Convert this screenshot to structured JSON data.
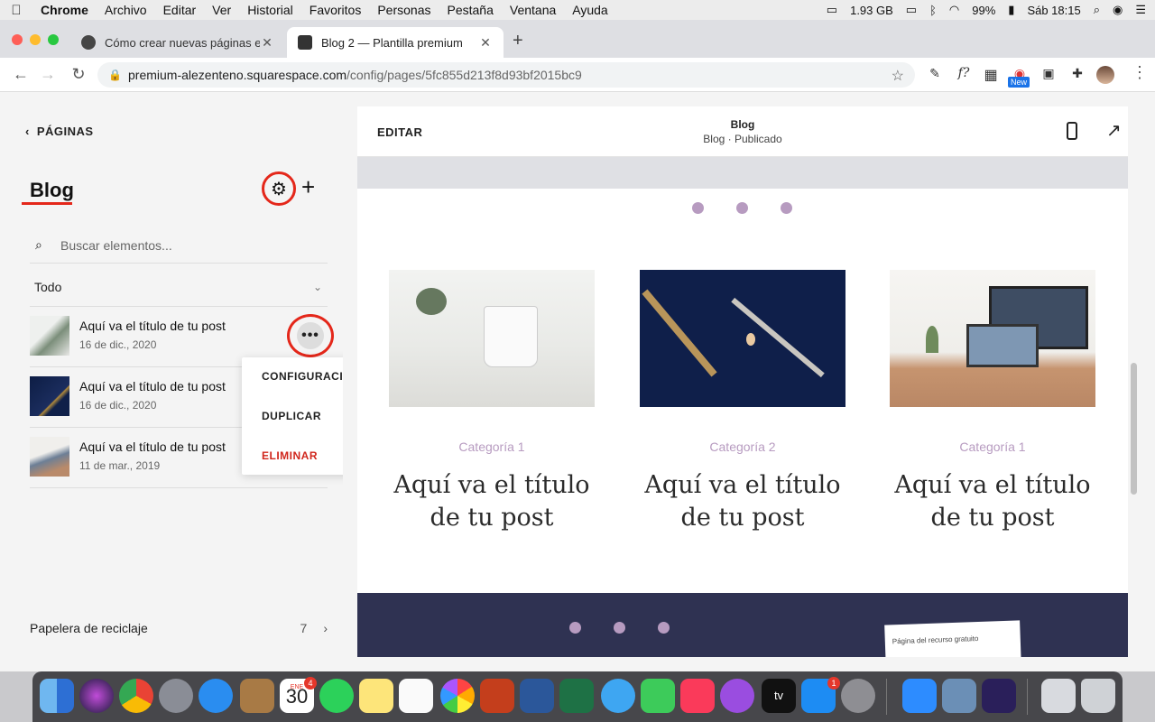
{
  "menubar": {
    "apple": "",
    "items": [
      "Chrome",
      "Archivo",
      "Editar",
      "Ver",
      "Historial",
      "Favoritos",
      "Personas",
      "Pestaña",
      "Ventana",
      "Ayuda"
    ],
    "memory": "1.93 GB",
    "battery": "99%",
    "clock": "Sáb 18:15"
  },
  "browser": {
    "tabs": [
      {
        "title": "Cómo crear nuevas páginas en",
        "close": "✕"
      },
      {
        "title": "Blog 2 — Plantilla premium",
        "close": "✕"
      }
    ],
    "new_tab": "+",
    "url_host": "premium-alezenteno.squarespace.com",
    "url_path": "/config/pages/5fc855d213f8d93bf2015bc9",
    "new_badge": "New"
  },
  "sidebar": {
    "back_label": "PÁGINAS",
    "title": "Blog",
    "search_placeholder": "Buscar elementos...",
    "filter_label": "Todo",
    "posts": [
      {
        "title": "Aquí va el título de tu post",
        "date": "16 de dic., 2020"
      },
      {
        "title": "Aquí va el título de tu post",
        "date": "16 de dic., 2020"
      },
      {
        "title": "Aquí va el título de tu post",
        "date": "11 de mar., 2019"
      }
    ],
    "more_glyph": "•••",
    "context_menu": {
      "settings": "CONFIGURACIÓN",
      "duplicate": "DUPLICAR",
      "delete": "ELIMINAR"
    },
    "trash_label": "Papelera de reciclaje",
    "trash_count": "7"
  },
  "preview": {
    "edit_label": "EDITAR",
    "page_title": "Blog",
    "page_status": "Blog · Publicado",
    "cards": [
      {
        "category": "Categoría 1",
        "title": "Aquí va el título de tu post",
        "image": "coffee-mug-desk"
      },
      {
        "category": "Categoría 2",
        "title": "Aquí va el título de tu post",
        "image": "navy-desk-tools"
      },
      {
        "category": "Categoría 1",
        "title": "Aquí va el título de tu post",
        "image": "laptop-workspace"
      }
    ],
    "footer_paper_text": "Página del recurso gratuito"
  },
  "dock": {
    "calendar_month": "ENE",
    "calendar_day": "30",
    "calendar_badge": "4",
    "appstore_badge": "1",
    "tv_label": "tv"
  },
  "colors": {
    "annotation_red": "#e4271a",
    "category_lilac": "#b79bc0",
    "footer_navy": "#2f3252",
    "delete_red": "#d0261c"
  }
}
